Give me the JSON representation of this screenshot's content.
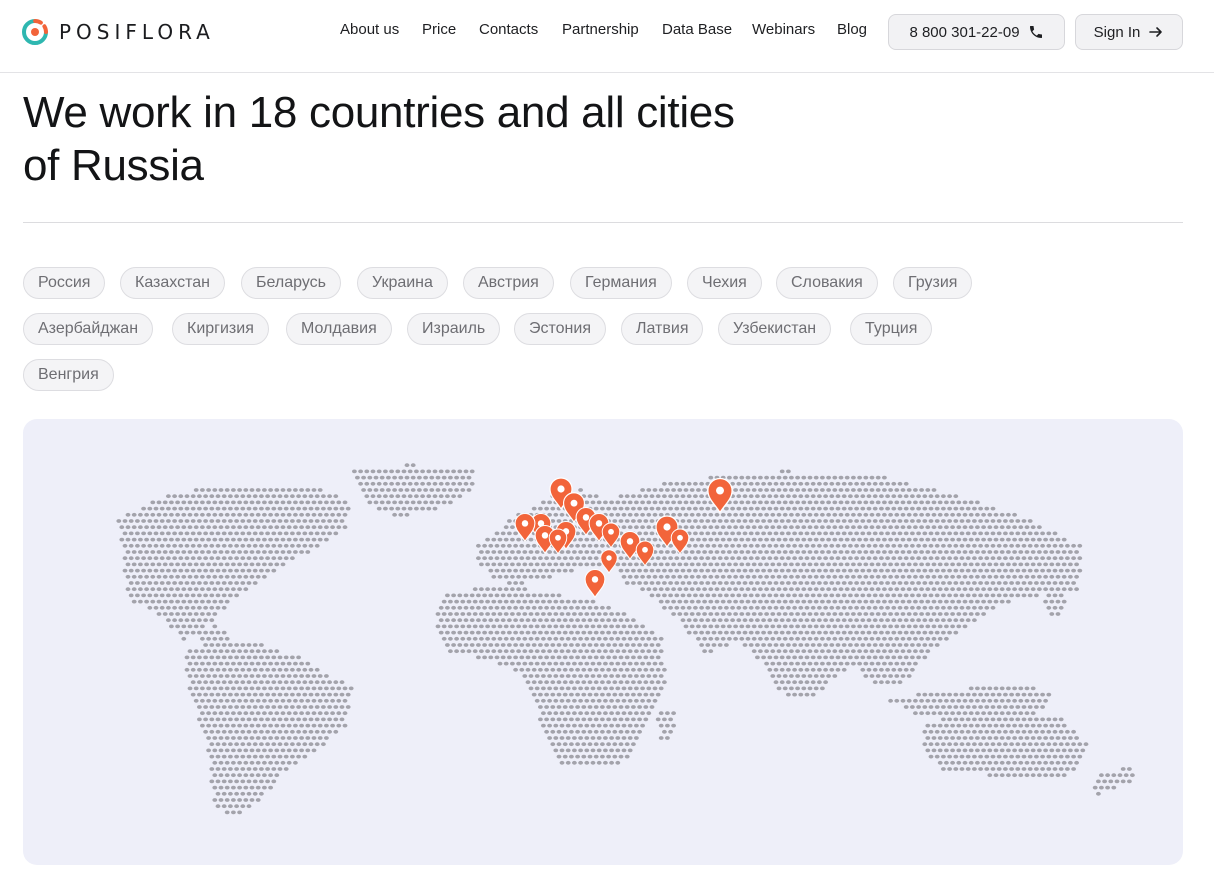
{
  "header": {
    "logo_text": "POSIFLORA",
    "nav": [
      "About us",
      "Price",
      "Contacts",
      "Partnership",
      "Data Base",
      "Webinars",
      "Blog"
    ],
    "phone": "8 800 301-22-09",
    "sign_in": "Sign In"
  },
  "hero": {
    "title_line1": "We work in 18 countries and all cities",
    "title_line2": "of Russia"
  },
  "countries": [
    "Россия",
    "Казахстан",
    "Беларусь",
    "Украина",
    "Австрия",
    "Германия",
    "Чехия",
    "Словакия",
    "Грузия",
    "Азербайджан",
    "Киргизия",
    "Молдавия",
    "Израиль",
    "Эстония",
    "Латвия",
    "Узбекистан",
    "Турция",
    "Венгрия"
  ],
  "colors": {
    "marker": "#f2643a",
    "map_dots": "#a3a3ab",
    "map_background": "#eeeff9",
    "logo_teal": "#2eb7b0",
    "logo_orange": "#f2643a"
  },
  "icons": {
    "phone": "phone-icon",
    "sign_in": "arrow-right-icon",
    "logo": "logo-icon",
    "marker": "map-pin-icon"
  }
}
